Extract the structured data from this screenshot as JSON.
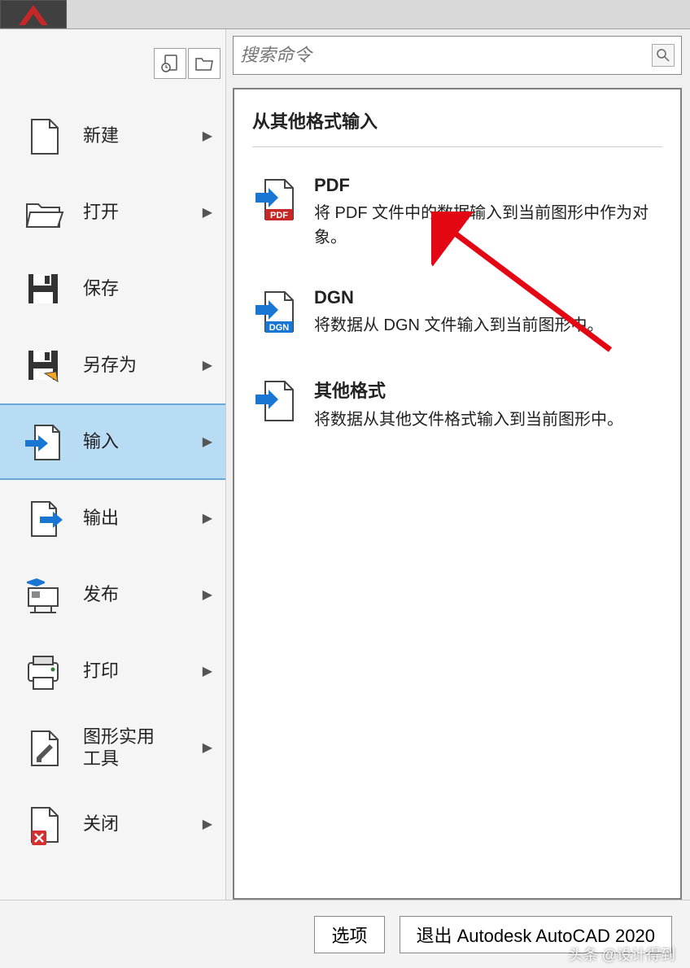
{
  "search": {
    "placeholder": "搜索命令"
  },
  "menu": {
    "items": [
      {
        "label": "新建",
        "arrow": true
      },
      {
        "label": "打开",
        "arrow": true
      },
      {
        "label": "保存",
        "arrow": false
      },
      {
        "label": "另存为",
        "arrow": true
      },
      {
        "label": "输入",
        "arrow": true,
        "active": true
      },
      {
        "label": "输出",
        "arrow": true
      },
      {
        "label": "发布",
        "arrow": true
      },
      {
        "label": "打印",
        "arrow": true
      },
      {
        "label": "图形实用\n工具",
        "arrow": true
      },
      {
        "label": "关闭",
        "arrow": true
      }
    ]
  },
  "submenu": {
    "title": "从其他格式输入",
    "items": [
      {
        "label": "PDF",
        "desc": "将 PDF 文件中的数据输入到当前图形中作为对象。",
        "icon": "pdf"
      },
      {
        "label": "DGN",
        "desc": "将数据从 DGN 文件输入到当前图形中。",
        "icon": "dgn"
      },
      {
        "label": "其他格式",
        "desc": "将数据从其他文件格式输入到当前图形中。",
        "icon": "other"
      }
    ]
  },
  "footer": {
    "options": "选项",
    "exit": "退出 Autodesk AutoCAD 2020"
  },
  "watermark": "头条 @设计得到"
}
